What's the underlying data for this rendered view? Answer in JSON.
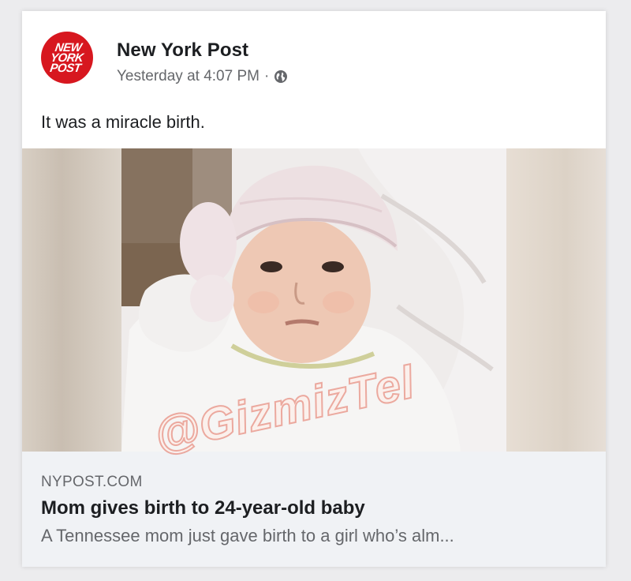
{
  "post": {
    "page_name": "New York Post",
    "avatar": {
      "logo_lines": [
        "NEW",
        "YORK",
        "POST"
      ],
      "bg_color": "#d7171f"
    },
    "timestamp": "Yesterday at 4:07 PM",
    "separator": "·",
    "audience_icon": "globe-icon",
    "text": "It was a miracle birth."
  },
  "media": {
    "watermark": "@GizmizTel"
  },
  "link_preview": {
    "domain": "NYPOST.COM",
    "title": "Mom gives birth to 24-year-old baby",
    "description": "A Tennessee mom just gave birth to a girl who’s alm..."
  },
  "colors": {
    "primary_text": "#1c1e21",
    "secondary_text": "#65676b",
    "preview_bg": "#f0f2f5",
    "brand_red": "#d7171f"
  }
}
